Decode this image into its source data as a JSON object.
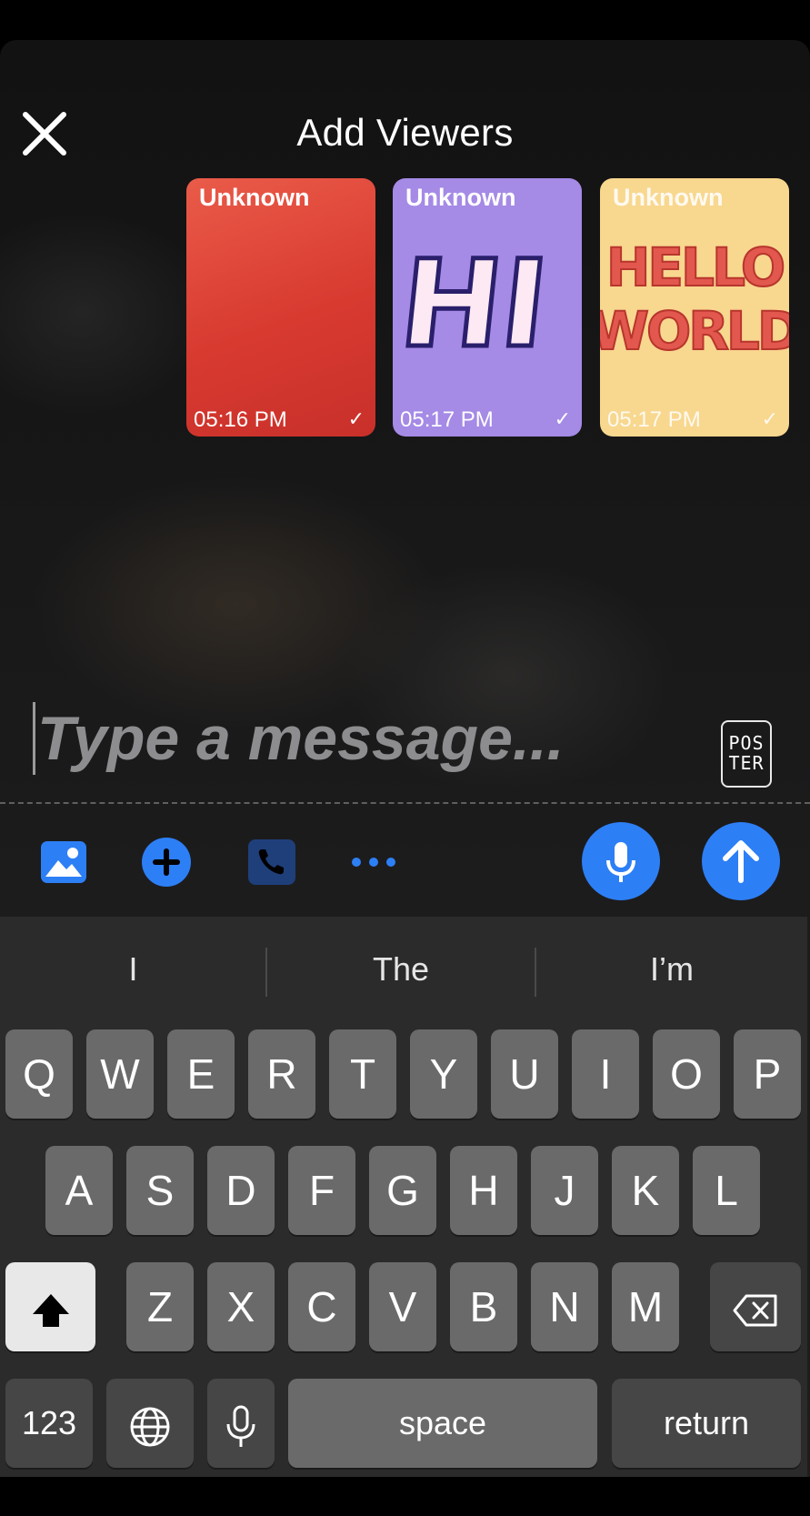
{
  "header": {
    "title": "Add Viewers"
  },
  "viewers": [
    {
      "name": "Unknown",
      "time": "05:16 PM",
      "status": "✓",
      "color": "#d83a30"
    },
    {
      "name": "Unknown",
      "time": "05:17 PM",
      "status": "✓",
      "color": "#a58ae6"
    },
    {
      "name": "Unknown",
      "time": "05:17 PM",
      "status": "✓",
      "color": "#f8d78f"
    }
  ],
  "cards_art": {
    "hi": "HI",
    "hello_line1": "HELLO",
    "hello_line2": "WORLD"
  },
  "composer": {
    "placeholder": "Type a message...",
    "poster_label_line1": "POS",
    "poster_label_line2": "TER",
    "accent_color": "#2d7ff5"
  },
  "toolbar_icons": [
    "photo-icon",
    "plus-icon",
    "phone-icon",
    "more-icon",
    "microphone-icon",
    "send-arrow-icon"
  ],
  "keyboard": {
    "suggestions": [
      "I",
      "The",
      "I’m"
    ],
    "row1": [
      "Q",
      "W",
      "E",
      "R",
      "T",
      "Y",
      "U",
      "I",
      "O",
      "P"
    ],
    "row2": [
      "A",
      "S",
      "D",
      "F",
      "G",
      "H",
      "J",
      "K",
      "L"
    ],
    "row3": [
      "Z",
      "X",
      "C",
      "V",
      "B",
      "N",
      "M"
    ],
    "numbers_label": "123",
    "space_label": "space",
    "return_label": "return"
  }
}
